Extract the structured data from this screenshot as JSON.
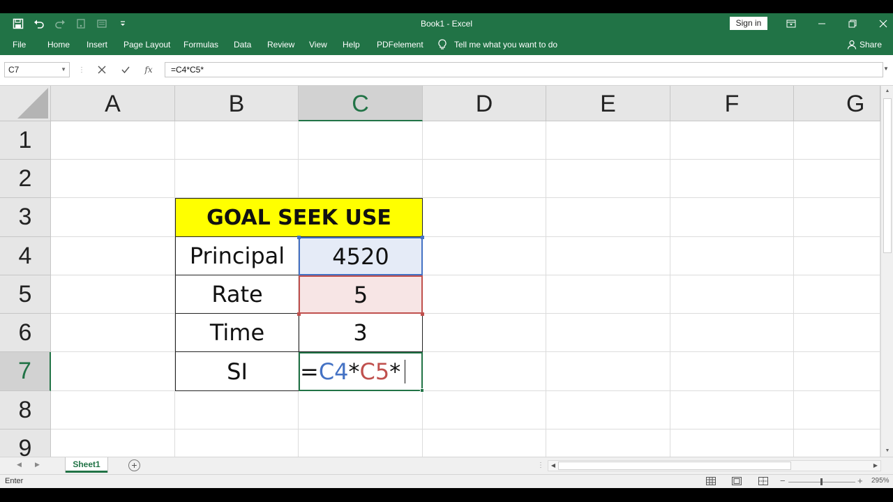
{
  "window": {
    "title": "Book1  -  Excel",
    "signin_label": "Sign in"
  },
  "icons": {
    "save": "save-icon",
    "undo": "undo-icon",
    "redo": "redo-icon",
    "customize": "customize-qat-icon",
    "tell_me": "lightbulb-icon",
    "share": "person-icon"
  },
  "ribbon": {
    "tabs": [
      "File",
      "Home",
      "Insert",
      "Page Layout",
      "Formulas",
      "Data",
      "Review",
      "View",
      "Help",
      "PDFelement"
    ],
    "tell_me": "Tell me what you want to do",
    "share": "Share"
  },
  "formula_bar": {
    "name_box": "C7",
    "fx_label": "fx",
    "formula": "=C4*C5*"
  },
  "grid": {
    "columns": [
      "A",
      "B",
      "C",
      "D",
      "E",
      "F",
      "G"
    ],
    "rows": [
      "1",
      "2",
      "3",
      "4",
      "5",
      "6",
      "7",
      "8",
      "9"
    ],
    "selected_column": "C",
    "selected_row": "7"
  },
  "table": {
    "title": "GOAL SEEK USE",
    "rows": [
      {
        "label": "Principal",
        "value": "4520"
      },
      {
        "label": "Rate",
        "value": "5"
      },
      {
        "label": "Time",
        "value": "3"
      },
      {
        "label": "SI",
        "value": ""
      }
    ],
    "editing": {
      "eq": "=",
      "ref1": "C4",
      "op1": "*",
      "ref2": "C5",
      "op2": "*"
    }
  },
  "sheets": {
    "tabs": [
      "Sheet1"
    ],
    "add_label": "+"
  },
  "status": {
    "mode": "Enter",
    "zoom": "295%"
  },
  "colors": {
    "accent": "#217346",
    "title_fill": "#ffff00",
    "ref1": "#4472c4",
    "ref2": "#c0504d"
  }
}
